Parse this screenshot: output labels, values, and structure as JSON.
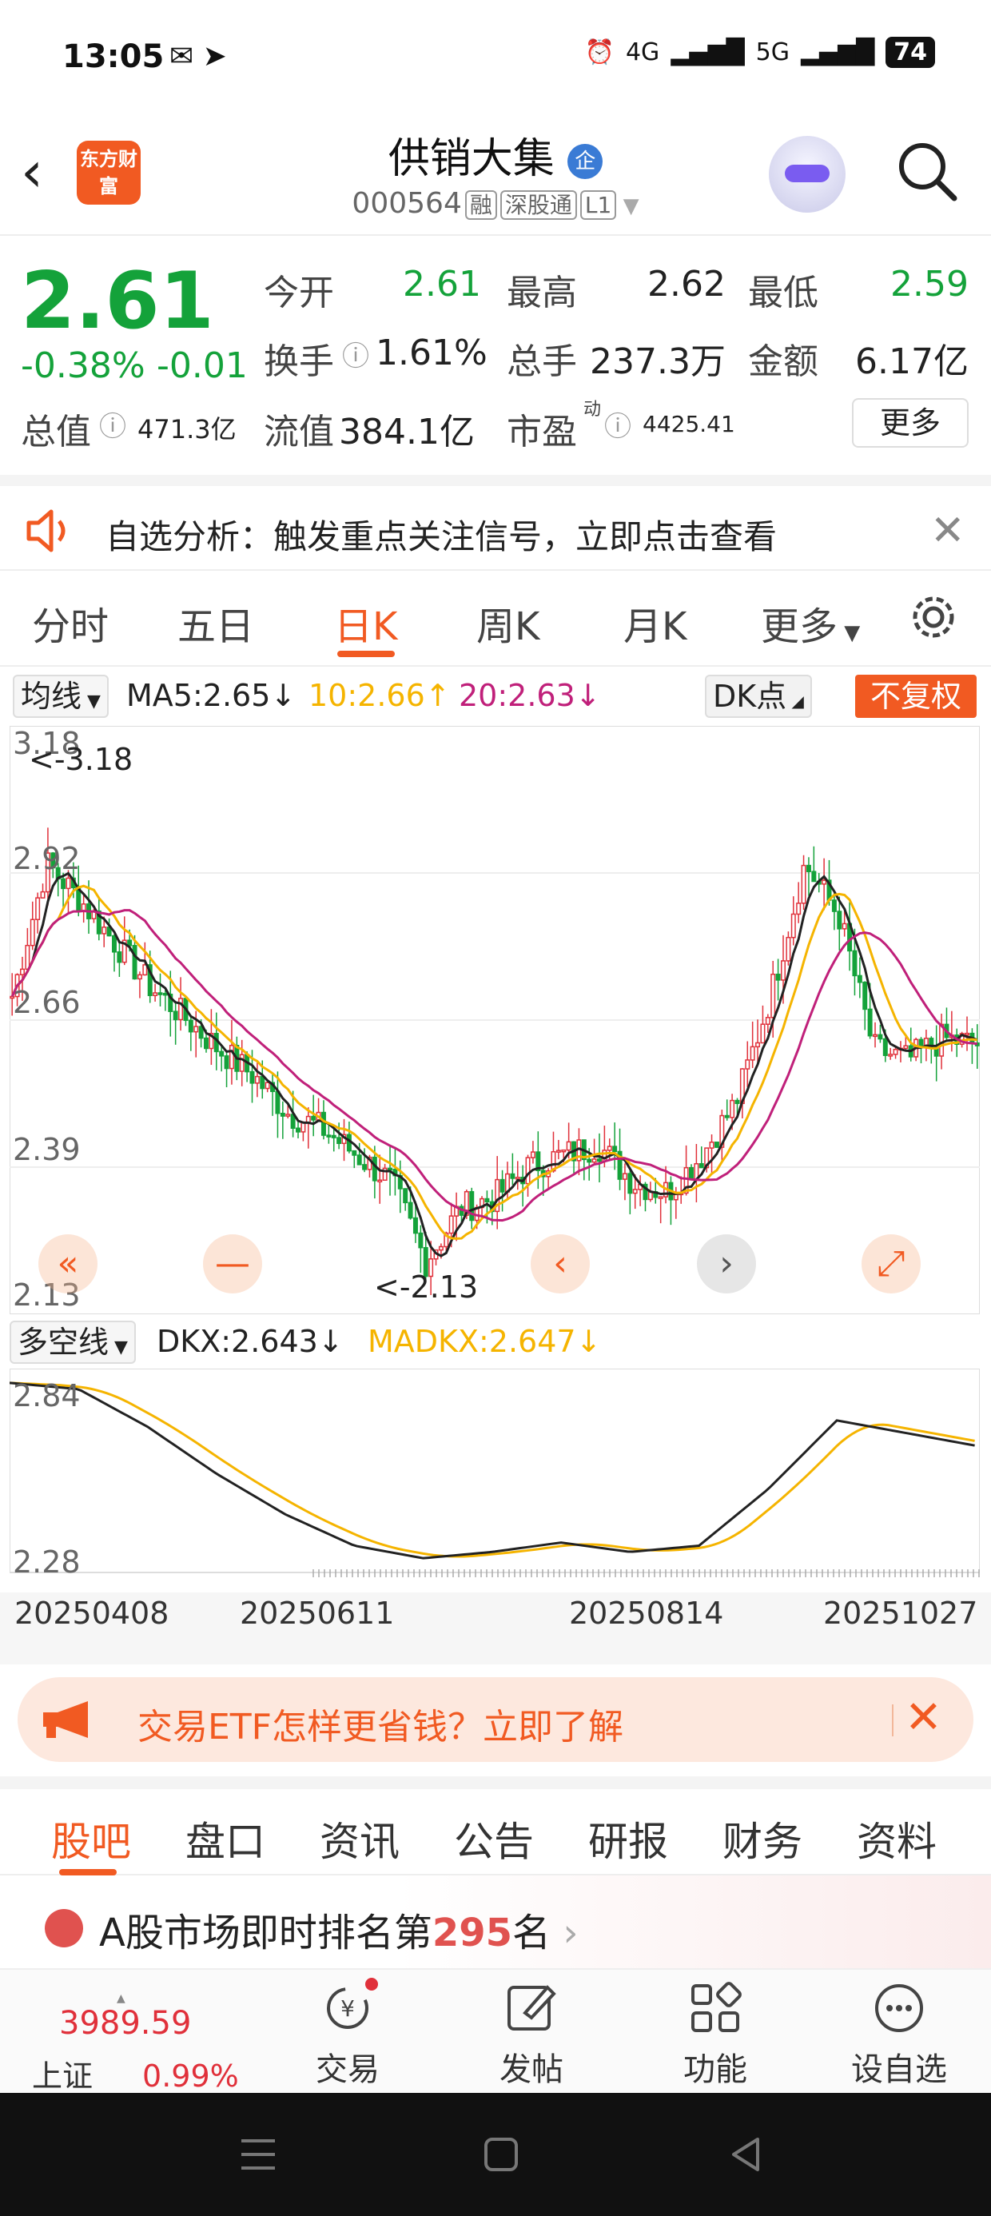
{
  "status": {
    "time": "13:05",
    "net1": "4G",
    "net2": "5G",
    "battery": "74"
  },
  "header": {
    "title": "供销大集",
    "qi_badge": "企",
    "code": "000564",
    "tags": [
      "融",
      "深股通",
      "L1"
    ],
    "logo": "东方财富"
  },
  "quote": {
    "price": "2.61",
    "change_pct": "-0.38%",
    "change": "-0.01",
    "open_label": "今开",
    "open": "2.61",
    "high_label": "最高",
    "high": "2.62",
    "low_label": "最低",
    "low": "2.59",
    "turnover_label": "换手",
    "turnover": "1.61%",
    "volume_label": "总手",
    "volume": "237.3万",
    "amount_label": "金额",
    "amount": "6.17亿",
    "mktcap_label": "总值",
    "mktcap": "471.3亿",
    "float_label": "流值",
    "float": "384.1亿",
    "pe_label": "市盈",
    "pe_sup": "动",
    "pe": "4425.41",
    "more_label": "更多"
  },
  "alert": {
    "text": "自选分析：触发重点关注信号，立即点击查看"
  },
  "tabs": [
    "分时",
    "五日",
    "日K",
    "周K",
    "月K",
    "更多"
  ],
  "active_tab": "日K",
  "indicator": {
    "select": "均线",
    "ma5": "MA5:2.65↓",
    "ma10": "10:2.66↑",
    "ma20": "20:2.63↓",
    "dk": "DK点",
    "fq": "不复权"
  },
  "chart_labels": {
    "y_top": "3.18",
    "y2": "2.92",
    "y3": "2.66",
    "y4": "2.39",
    "y_bottom": "2.13",
    "max_note": "<-3.18",
    "min_note": "<-2.13"
  },
  "sub_indicator": {
    "select": "多空线",
    "dkx": "DKX:2.643↓",
    "madkx": "MADKX:2.647↓",
    "y_top": "2.84",
    "y_bottom": "2.28"
  },
  "dates": [
    "20250408",
    "20250611",
    "20250814",
    "20251027"
  ],
  "etf_banner": {
    "text": "交易ETF怎样更省钱？立即了解"
  },
  "bottom_tabs": [
    "股吧",
    "盘口",
    "资讯",
    "公告",
    "研报",
    "财务",
    "资料"
  ],
  "rank": {
    "prefix": "A股市场即时排名第",
    "num": "295",
    "suffix": "名"
  },
  "toolbar": {
    "index_value": "3989.59",
    "index_name": "上证",
    "index_pct": "0.99%",
    "trade": "交易",
    "post": "发帖",
    "func": "功能",
    "watch": "设自选"
  },
  "colors": {
    "accent": "#f15a22",
    "up": "#e0303a",
    "down": "#14a23a",
    "ma10": "#f5b400",
    "ma20": "#c0207a"
  },
  "chart_data": {
    "type": "candlestick",
    "ylim": [
      2.13,
      3.18
    ],
    "note": "daily K-line 20250408–20251027",
    "close_trend": [
      2.7,
      2.95,
      2.88,
      2.8,
      2.72,
      2.66,
      2.6,
      2.55,
      2.48,
      2.45,
      2.4,
      2.35,
      2.2,
      2.3,
      2.32,
      2.38,
      2.4,
      2.42,
      2.35,
      2.33,
      2.4,
      2.5,
      2.7,
      2.95,
      2.85,
      2.6,
      2.58,
      2.62,
      2.61
    ],
    "dkx": [
      2.84,
      2.82,
      2.7,
      2.55,
      2.42,
      2.32,
      2.28,
      2.3,
      2.33,
      2.3,
      2.32,
      2.5,
      2.72,
      2.68,
      2.64
    ]
  }
}
